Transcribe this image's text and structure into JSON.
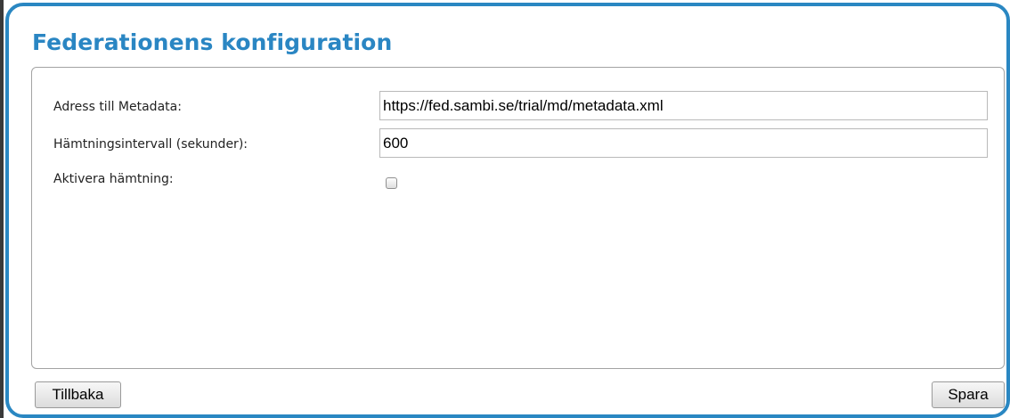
{
  "dialog": {
    "title": "Federationens konfiguration"
  },
  "form": {
    "metadata_address": {
      "label": "Adress till Metadata:",
      "value": "https://fed.sambi.se/trial/md/metadata.xml"
    },
    "fetch_interval": {
      "label": "Hämtningsintervall (sekunder):",
      "value": "600"
    },
    "enable_fetch": {
      "label": "Aktivera hämtning:",
      "checked": false
    }
  },
  "buttons": {
    "back_label": "Tillbaka",
    "save_label": "Spara"
  },
  "colors": {
    "accent": "#2a86c3",
    "panel_border": "#a3a3a3"
  }
}
